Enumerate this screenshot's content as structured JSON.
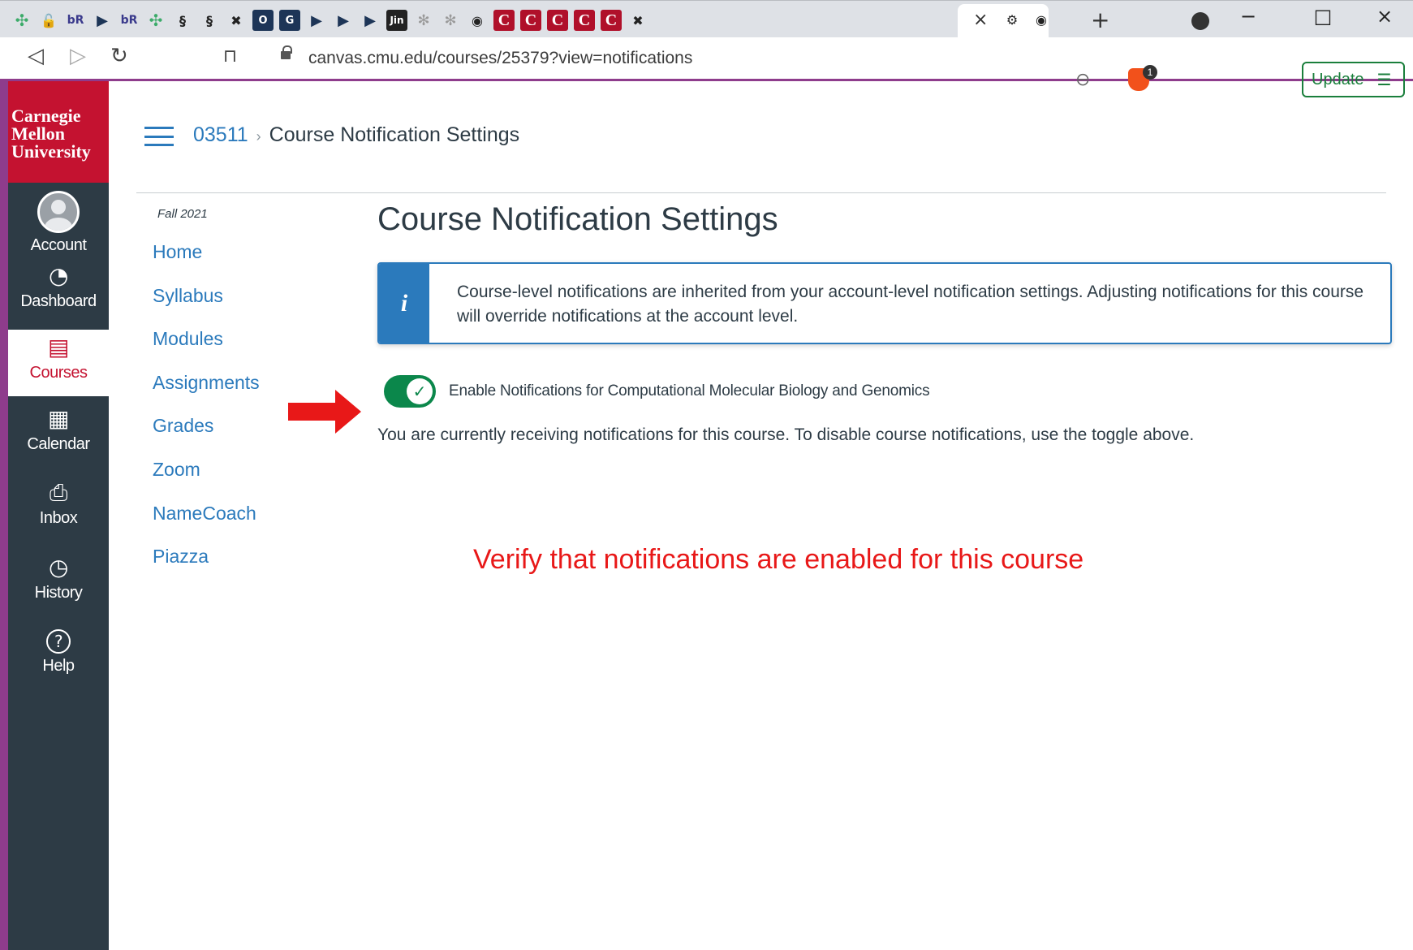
{
  "browser": {
    "tabs": [
      {
        "glyph": "✣",
        "kind": "slack",
        "icon": "slack-icon"
      },
      {
        "glyph": "🔓",
        "kind": "",
        "icon": "lock-open-icon"
      },
      {
        "glyph": "bR",
        "kind": "br",
        "icon": "br-icon"
      },
      {
        "glyph": "▶",
        "kind": "dark-arrow",
        "icon": "arrow-icon"
      },
      {
        "glyph": "bR",
        "kind": "br",
        "icon": "br-icon"
      },
      {
        "glyph": "✣",
        "kind": "slack",
        "icon": "slack-icon"
      },
      {
        "glyph": "§",
        "kind": "",
        "icon": "dna-icon"
      },
      {
        "glyph": "§",
        "kind": "",
        "icon": "dna-icon"
      },
      {
        "glyph": "✖",
        "kind": "",
        "icon": "crest-icon"
      },
      {
        "glyph": "O",
        "kind": "dark",
        "icon": "o-icon"
      },
      {
        "glyph": "G",
        "kind": "dark",
        "icon": "g-icon"
      },
      {
        "glyph": "▶",
        "kind": "dark-arrow",
        "icon": "arrow-icon"
      },
      {
        "glyph": "▶",
        "kind": "dark-arrow",
        "icon": "arrow-icon"
      },
      {
        "glyph": "▶",
        "kind": "dark-arrow",
        "icon": "arrow-icon"
      },
      {
        "glyph": "Jin",
        "kind": "black",
        "icon": "jin-icon"
      },
      {
        "glyph": "✻",
        "kind": "gray",
        "icon": "gear-icon"
      },
      {
        "glyph": "✻",
        "kind": "gray",
        "icon": "gear-icon"
      },
      {
        "glyph": "◉",
        "kind": "",
        "icon": "globe-icon"
      },
      {
        "glyph": "C",
        "kind": "red",
        "icon": "canvas-icon"
      },
      {
        "glyph": "C",
        "kind": "red",
        "icon": "canvas-icon"
      },
      {
        "glyph": "C",
        "kind": "red",
        "icon": "canvas-icon"
      },
      {
        "glyph": "C",
        "kind": "red",
        "icon": "canvas-icon"
      },
      {
        "glyph": "C",
        "kind": "red",
        "icon": "canvas-icon"
      },
      {
        "glyph": "✖",
        "kind": "",
        "icon": "crest-icon"
      }
    ],
    "active_tab_close": "×",
    "after_tabs": [
      {
        "glyph": "⚙",
        "icon": "settings-icon"
      },
      {
        "glyph": "◉",
        "icon": "globe-icon"
      }
    ],
    "new_tab": "+",
    "window": {
      "minimize": "−",
      "maximize": "□",
      "close": "×"
    },
    "url": "canvas.cmu.edu/courses/25379?view=notifications",
    "brave_badge": "1",
    "update_label": "Update",
    "update_menu": "☰"
  },
  "logo": {
    "line1": "Carnegie",
    "line2": "Mellon",
    "line3": "University"
  },
  "global_nav": [
    {
      "label": "Account",
      "icon": "avatar-icon",
      "glyph": ""
    },
    {
      "label": "Dashboard",
      "icon": "dashboard-icon",
      "glyph": "◔"
    },
    {
      "label": "Courses",
      "icon": "courses-icon",
      "glyph": "▤"
    },
    {
      "label": "Calendar",
      "icon": "calendar-icon",
      "glyph": "▦"
    },
    {
      "label": "Inbox",
      "icon": "inbox-icon",
      "glyph": "⎙"
    },
    {
      "label": "History",
      "icon": "history-icon",
      "glyph": "◷"
    },
    {
      "label": "Help",
      "icon": "help-icon",
      "glyph": "?"
    }
  ],
  "breadcrumb": {
    "course": "03511",
    "separator": "›",
    "current": "Course Notification Settings"
  },
  "course_nav": {
    "term": "Fall 2021",
    "links": [
      "Home",
      "Syllabus",
      "Modules",
      "Assignments",
      "Grades",
      "Zoom",
      "NameCoach",
      "Piazza"
    ]
  },
  "main": {
    "title": "Course Notification Settings",
    "alert_icon": "i",
    "alert_text": "Course-level notifications are inherited from your account-level notification settings. Adjusting notifications for this course will override notifications at the account level.",
    "toggle_label": "Enable Notifications for Computational Molecular Biology and Genomics",
    "toggle_on": true,
    "toggle_check": "✓",
    "status_text": "You are currently receiving notifications for this course. To disable course notifications, use the toggle above."
  },
  "annotation": {
    "text": "Verify that notifications are enabled for this course",
    "color": "#e81818"
  },
  "colors": {
    "accent": "#2b7abc",
    "brand": "#c41230",
    "nav_bg": "#2d3b45",
    "toggle_on": "#0b874b",
    "frame": "#8e3c8c"
  }
}
